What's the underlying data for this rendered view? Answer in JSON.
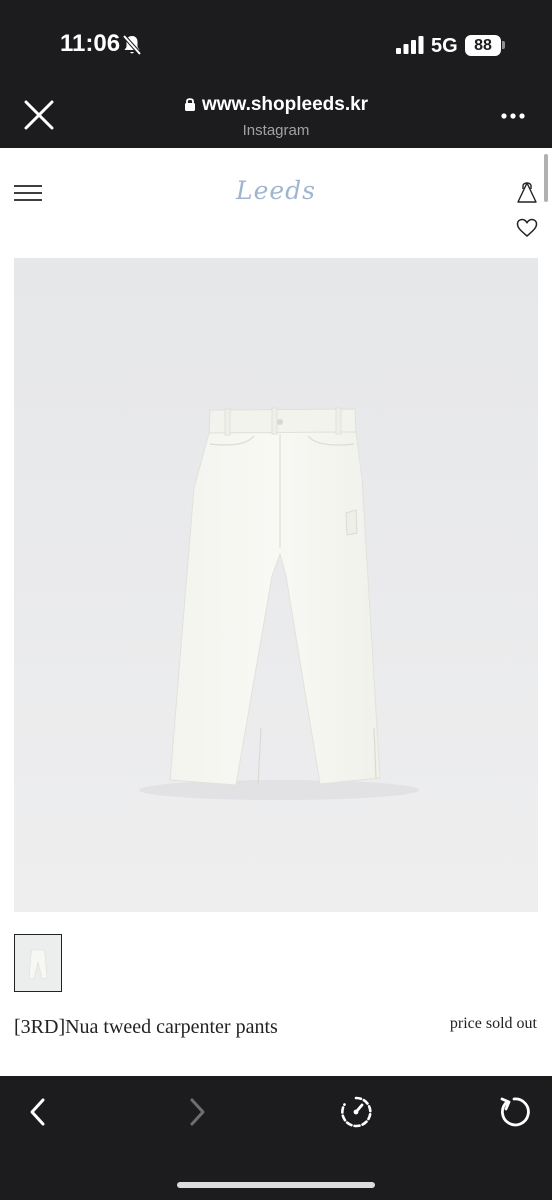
{
  "status_bar": {
    "time": "11:06",
    "network": "5G",
    "battery": "88"
  },
  "browser": {
    "url": "www.shopleeds.kr",
    "subtitle": "Instagram"
  },
  "site": {
    "logo": "Leeds"
  },
  "product": {
    "name": "[3RD]Nua tweed carpenter pants",
    "price_status": "price sold out"
  },
  "colors": {
    "chrome": "#1c1c1e",
    "logo": "#9fb4cf",
    "image_bg": "#eaebed"
  },
  "icons": [
    "bell-slash-icon",
    "signal-icon",
    "lock-icon",
    "close-icon",
    "more-icon",
    "menu-icon",
    "bag-icon",
    "heart-icon",
    "back-icon",
    "forward-icon",
    "speedometer-icon",
    "reload-icon"
  ]
}
